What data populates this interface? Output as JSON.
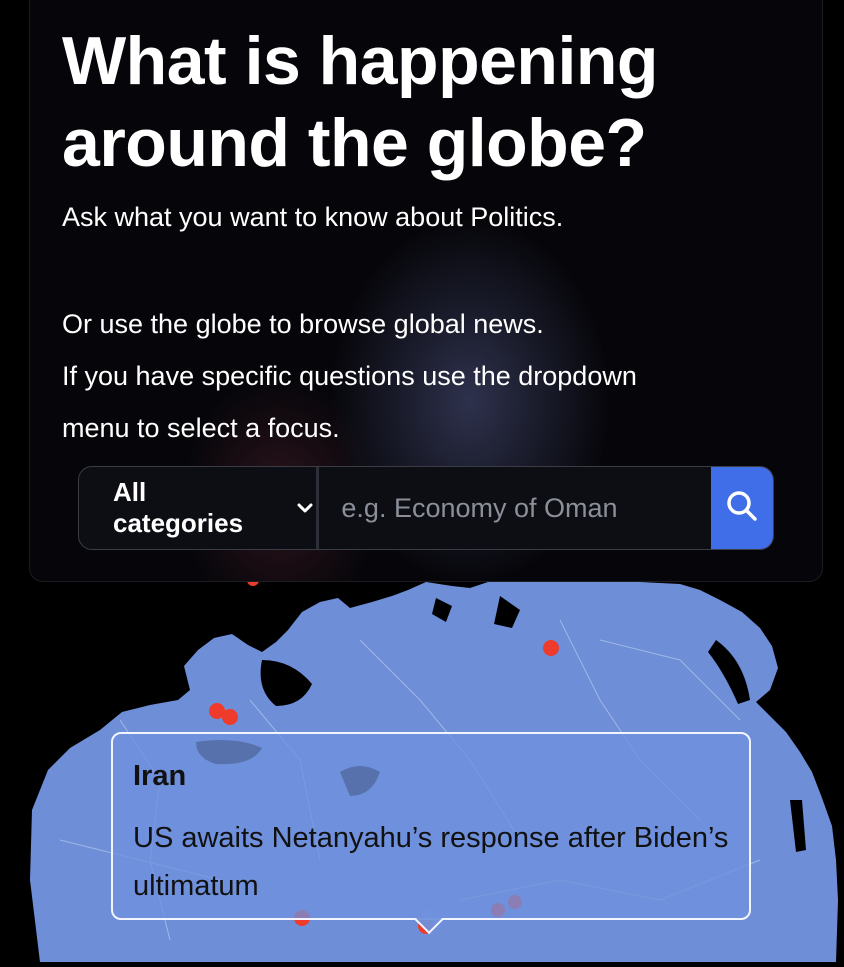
{
  "hero": {
    "title_line1": "What is happening",
    "title_line2": "around the globe?",
    "subtitle": "Ask what you want to know about Politics.",
    "desc_line1": "Or use the globe to browse global news.",
    "desc_line2": "If you have specific questions use the dropdown",
    "desc_line3": "menu to select a focus."
  },
  "search": {
    "category_label": "All categories",
    "placeholder": "e.g. Economy of Oman",
    "value": ""
  },
  "tooltip": {
    "country": "Iran",
    "headline": "US awaits Netanyahu’s response after Biden’s ultimatum"
  },
  "icons": {
    "dropdown": "chevron-down-icon",
    "search": "search-icon",
    "marker": "news-marker-icon"
  },
  "colors": {
    "accent": "#3f6ee8",
    "land": "#6e8fd8",
    "marker": "#ee3b2c",
    "background": "#000000"
  }
}
